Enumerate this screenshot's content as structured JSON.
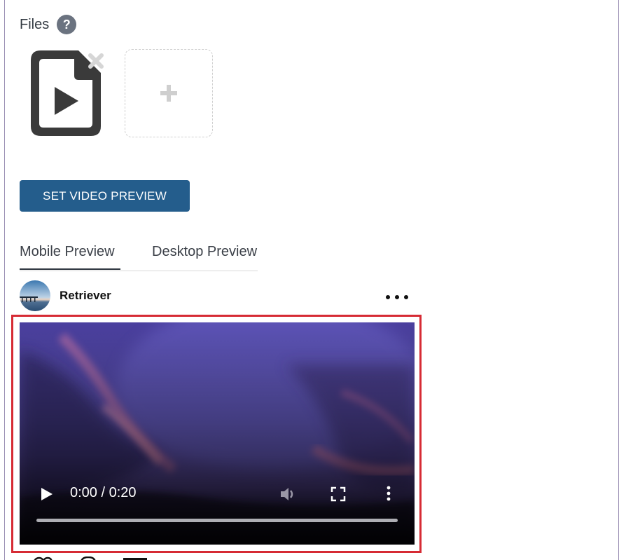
{
  "files": {
    "label": "Files",
    "help_symbol": "?",
    "items": [
      {
        "icon": "video-file-icon"
      }
    ],
    "add_symbol": "+"
  },
  "actions": {
    "set_video_preview_label": "SET VIDEO PREVIEW"
  },
  "tabs": [
    {
      "label": "Mobile Preview",
      "active": true
    },
    {
      "label": "Desktop Preview",
      "active": false
    }
  ],
  "post": {
    "author": "Retriever",
    "more_icon": "more-horizontal-icon"
  },
  "video": {
    "time_display": "0:00 / 0:20",
    "progress": 0,
    "controls": [
      "play-icon",
      "volume-icon",
      "fullscreen-icon",
      "more-vertical-icon"
    ]
  },
  "colors": {
    "primary_button": "#245d8c",
    "highlight_border": "#d62b34",
    "help_icon": "#6b7380"
  }
}
